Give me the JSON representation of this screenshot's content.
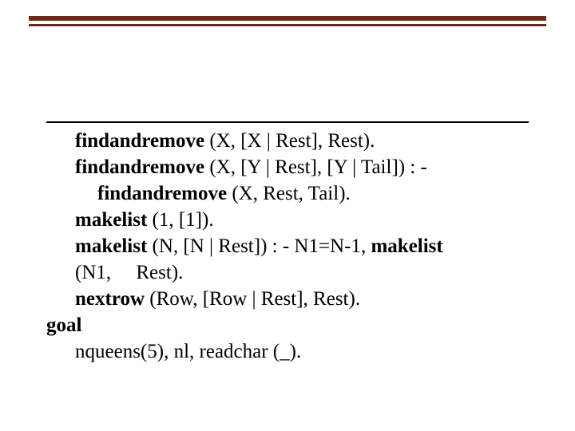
{
  "code": {
    "l1a": "findandremove",
    "l1b": " (X, [X | Rest], Rest).",
    "l2a": "findandremove",
    "l2b": " (X, [Y | Rest], [Y | Tail]) : -",
    "l3a": "findandremove",
    "l3b": " (X, Rest, Tail).",
    "l4a": "makelist",
    "l4b": " (1, [1]).",
    "l5a": "makelist",
    "l5b": " (N, [N | Rest]) : - N1=N-1, ",
    "l5c": "makelist",
    "l6": "(N1,     Rest).",
    "l7a": "nextrow",
    "l7b": " (Row, [Row | Rest], Rest).",
    "l8": "goal",
    "l9": "nqueens(5), nl, readchar (_)."
  }
}
